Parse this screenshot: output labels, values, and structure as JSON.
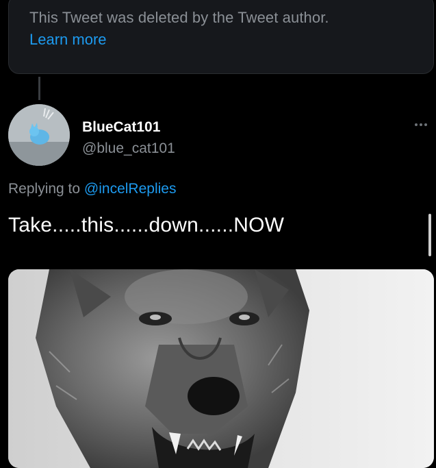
{
  "deleted_notice": {
    "message": "This Tweet was deleted by the Tweet author.",
    "learn_more": "Learn more"
  },
  "tweet": {
    "author": {
      "display_name": "BlueCat101",
      "handle": "@blue_cat101"
    },
    "replying_to_prefix": "Replying to",
    "replying_to_handle": "@incelReplies",
    "text": "Take.....this......down......NOW",
    "more_icon": "more-options-icon",
    "media_description_icon": "photo"
  },
  "colors": {
    "background": "#000000",
    "card": "#16181c",
    "secondary_text": "#8b9096",
    "link": "#1d9bf0",
    "primary_text": "#ffffff"
  }
}
